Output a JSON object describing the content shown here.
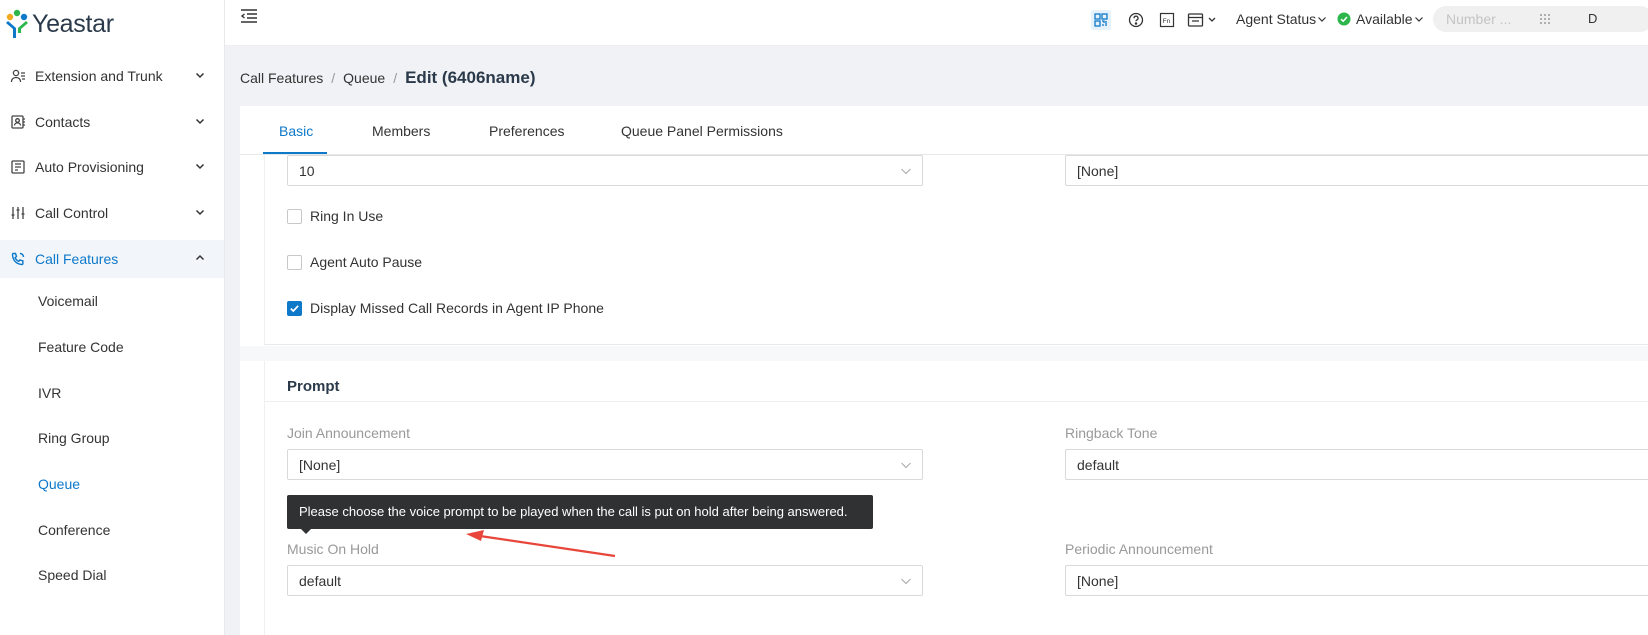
{
  "app": {
    "brand": "Yeastar",
    "colors": {
      "accent": "#0e78c9",
      "tooltip_bg": "#303133",
      "annotation_arrow": "#e8463a",
      "status_green": "#2cb64b"
    }
  },
  "sidebar": {
    "items": [
      {
        "label": "Extension and Trunk",
        "icon": "user-list-icon",
        "expanded": false
      },
      {
        "label": "Contacts",
        "icon": "contacts-book-icon",
        "expanded": false
      },
      {
        "label": "Auto Provisioning",
        "icon": "phone-provision-icon",
        "expanded": false
      },
      {
        "label": "Call Control",
        "icon": "sliders-icon",
        "expanded": false
      },
      {
        "label": "Call Features",
        "icon": "phone-call-icon",
        "expanded": true,
        "active": true
      }
    ],
    "sub_items": [
      "Voicemail",
      "Feature Code",
      "IVR",
      "Ring Group",
      "Queue",
      "Conference",
      "Speed Dial"
    ],
    "active_sub_item": "Queue"
  },
  "topbar": {
    "agent_status_label": "Agent Status",
    "availability_label": "Available",
    "search_placeholder": "Number ...",
    "cut_off_text": "D"
  },
  "breadcrumb": {
    "items": [
      "Call Features",
      "Queue"
    ],
    "current": "Edit (6406name)"
  },
  "tabs": {
    "items": [
      "Basic",
      "Members",
      "Preferences",
      "Queue Panel Permissions"
    ],
    "active": "Basic"
  },
  "basic": {
    "top_select_left_value": "10",
    "top_select_right_value": "[None]",
    "checkboxes": [
      {
        "label": "Ring In Use",
        "checked": false
      },
      {
        "label": "Agent Auto Pause",
        "checked": false
      },
      {
        "label": "Display Missed Call Records in Agent IP Phone",
        "checked": true
      }
    ]
  },
  "prompt": {
    "section_title": "Prompt",
    "join_announcement_label": "Join Announcement",
    "join_announcement_value": "[None]",
    "ringback_tone_label": "Ringback Tone",
    "ringback_tone_value": "default",
    "music_on_hold_label": "Music On Hold",
    "music_on_hold_value": "default",
    "periodic_announcement_label": "Periodic Announcement",
    "periodic_announcement_value": "[None]",
    "tooltip_text": "Please choose the voice prompt to be played when the call is put on hold after being answered."
  }
}
